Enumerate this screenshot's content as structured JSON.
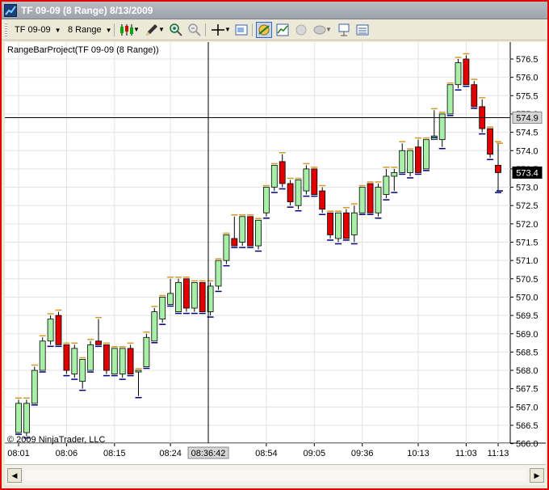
{
  "window": {
    "title": "TF 09-09 (8 Range)  8/13/2009"
  },
  "toolbar": {
    "instrument": "TF 09-09",
    "interval": "8 Range"
  },
  "chart": {
    "series_label": "RangeBarProject(TF 09-09 (8 Range))",
    "copyright": "© 2009 NinjaTrader, LLC",
    "crosshair_time_label": "08:36:42",
    "crosshair_price_label": "574.9",
    "last_price_label": "573.4",
    "colors": {
      "up": "#a8f0a8",
      "down": "#e00000",
      "grid": "#e3e3e3",
      "high_mark": "#d49a2a",
      "low_mark": "#00007a"
    }
  },
  "chart_data": {
    "type": "candlestick",
    "title": "RangeBarProject(TF 09-09 (8 Range))",
    "ylim": [
      566.0,
      576.7
    ],
    "y_ticks": [
      "576.5",
      "576.0",
      "575.5",
      "575.0",
      "574.5",
      "574.0",
      "573.5",
      "573.0",
      "572.5",
      "572.0",
      "571.5",
      "571.0",
      "570.5",
      "570.0",
      "569.5",
      "569.0",
      "568.5",
      "568.0",
      "567.5",
      "567.0",
      "566.5",
      "566.0"
    ],
    "x_tick_labels": [
      "08:01",
      "08:06",
      "08:15",
      "08:24",
      "08:54",
      "09:05",
      "09:36",
      "10:13",
      "11:03",
      "11:13"
    ],
    "bars": [
      {
        "o": 566.3,
        "c": 567.1,
        "h": 567.2,
        "l": 566.3
      },
      {
        "o": 566.3,
        "c": 567.1,
        "h": 567.2,
        "l": 566.2
      },
      {
        "o": 567.1,
        "c": 568.0,
        "h": 568.1,
        "l": 567.1
      },
      {
        "o": 568.0,
        "c": 568.8,
        "h": 568.9,
        "l": 568.0
      },
      {
        "o": 568.8,
        "c": 569.4,
        "h": 569.5,
        "l": 568.7
      },
      {
        "o": 569.5,
        "c": 568.7,
        "h": 569.6,
        "l": 568.7
      },
      {
        "o": 568.7,
        "c": 568.0,
        "h": 568.7,
        "l": 567.9
      },
      {
        "o": 567.9,
        "c": 568.6,
        "h": 568.7,
        "l": 567.8
      },
      {
        "o": 567.7,
        "c": 568.3,
        "h": 568.3,
        "l": 567.5
      },
      {
        "o": 568.0,
        "c": 568.7,
        "h": 568.8,
        "l": 568.0
      },
      {
        "o": 568.8,
        "c": 568.7,
        "h": 569.4,
        "l": 568.7
      },
      {
        "o": 568.7,
        "c": 568.0,
        "h": 568.7,
        "l": 567.9
      },
      {
        "o": 567.9,
        "c": 568.6,
        "h": 568.6,
        "l": 567.9
      },
      {
        "o": 567.9,
        "c": 568.6,
        "h": 568.6,
        "l": 567.8
      },
      {
        "o": 568.6,
        "c": 567.9,
        "h": 568.7,
        "l": 567.9
      },
      {
        "o": 568.0,
        "c": 568.0,
        "h": 568.0,
        "l": 567.3
      },
      {
        "o": 568.1,
        "c": 568.9,
        "h": 569.0,
        "l": 568.1
      },
      {
        "o": 568.8,
        "c": 569.6,
        "h": 569.7,
        "l": 568.8
      },
      {
        "o": 569.4,
        "c": 570.0,
        "h": 570.0,
        "l": 569.3
      },
      {
        "o": 569.8,
        "c": 570.1,
        "h": 570.5,
        "l": 569.8
      },
      {
        "o": 569.6,
        "c": 570.4,
        "h": 570.5,
        "l": 569.6
      },
      {
        "o": 570.5,
        "c": 569.7,
        "h": 570.5,
        "l": 569.6
      },
      {
        "o": 569.7,
        "c": 570.4,
        "h": 570.4,
        "l": 569.6
      },
      {
        "o": 570.4,
        "c": 569.6,
        "h": 570.4,
        "l": 569.6
      },
      {
        "o": 569.6,
        "c": 570.3,
        "h": 570.4,
        "l": 569.5
      },
      {
        "o": 570.3,
        "c": 571.0,
        "h": 571.0,
        "l": 570.2
      },
      {
        "o": 571.0,
        "c": 571.7,
        "h": 571.7,
        "l": 570.9
      },
      {
        "o": 571.6,
        "c": 571.4,
        "h": 572.2,
        "l": 571.4
      },
      {
        "o": 571.5,
        "c": 572.2,
        "h": 572.2,
        "l": 571.4
      },
      {
        "o": 572.2,
        "c": 571.4,
        "h": 572.2,
        "l": 571.4
      },
      {
        "o": 571.4,
        "c": 572.1,
        "h": 572.1,
        "l": 571.3
      },
      {
        "o": 572.3,
        "c": 573.0,
        "h": 573.0,
        "l": 572.2
      },
      {
        "o": 573.0,
        "c": 573.6,
        "h": 573.6,
        "l": 572.9
      },
      {
        "o": 573.7,
        "c": 573.1,
        "h": 573.9,
        "l": 573.0
      },
      {
        "o": 573.1,
        "c": 572.6,
        "h": 573.2,
        "l": 572.5
      },
      {
        "o": 572.5,
        "c": 573.2,
        "h": 573.2,
        "l": 572.4
      },
      {
        "o": 572.9,
        "c": 573.5,
        "h": 573.6,
        "l": 572.8
      },
      {
        "o": 573.5,
        "c": 572.8,
        "h": 573.5,
        "l": 572.8
      },
      {
        "o": 572.9,
        "c": 572.4,
        "h": 573.0,
        "l": 572.3
      },
      {
        "o": 572.3,
        "c": 571.7,
        "h": 572.3,
        "l": 571.6
      },
      {
        "o": 571.6,
        "c": 572.3,
        "h": 572.3,
        "l": 571.5
      },
      {
        "o": 572.3,
        "c": 571.6,
        "h": 572.4,
        "l": 571.6
      },
      {
        "o": 571.7,
        "c": 572.3,
        "h": 572.5,
        "l": 571.5
      },
      {
        "o": 572.3,
        "c": 573.0,
        "h": 573.0,
        "l": 572.3
      },
      {
        "o": 573.1,
        "c": 572.3,
        "h": 573.1,
        "l": 572.3
      },
      {
        "o": 572.3,
        "c": 573.0,
        "h": 573.1,
        "l": 572.2
      },
      {
        "o": 572.8,
        "c": 573.3,
        "h": 573.5,
        "l": 572.7
      },
      {
        "o": 573.3,
        "c": 573.4,
        "h": 573.5,
        "l": 572.9
      },
      {
        "o": 573.4,
        "c": 574.0,
        "h": 574.2,
        "l": 573.4
      },
      {
        "o": 573.4,
        "c": 574.0,
        "h": 574.0,
        "l": 573.3
      },
      {
        "o": 574.1,
        "c": 573.4,
        "h": 574.3,
        "l": 573.4
      },
      {
        "o": 573.5,
        "c": 574.3,
        "h": 574.3,
        "l": 573.5
      },
      {
        "o": 574.3,
        "c": 574.4,
        "h": 575.1,
        "l": 574.4
      },
      {
        "o": 574.3,
        "c": 575.0,
        "h": 575.0,
        "l": 574.1
      },
      {
        "o": 575.0,
        "c": 575.8,
        "h": 575.8,
        "l": 575.0
      },
      {
        "o": 575.8,
        "c": 576.4,
        "h": 576.5,
        "l": 575.7
      },
      {
        "o": 576.5,
        "c": 575.8,
        "h": 576.6,
        "l": 575.8
      },
      {
        "o": 575.8,
        "c": 575.2,
        "h": 575.9,
        "l": 575.2
      },
      {
        "o": 575.2,
        "c": 574.6,
        "h": 575.4,
        "l": 574.5
      },
      {
        "o": 574.6,
        "c": 573.9,
        "h": 574.6,
        "l": 573.8
      },
      {
        "o": 573.6,
        "c": 573.4,
        "h": 574.2,
        "l": 572.9
      }
    ]
  }
}
